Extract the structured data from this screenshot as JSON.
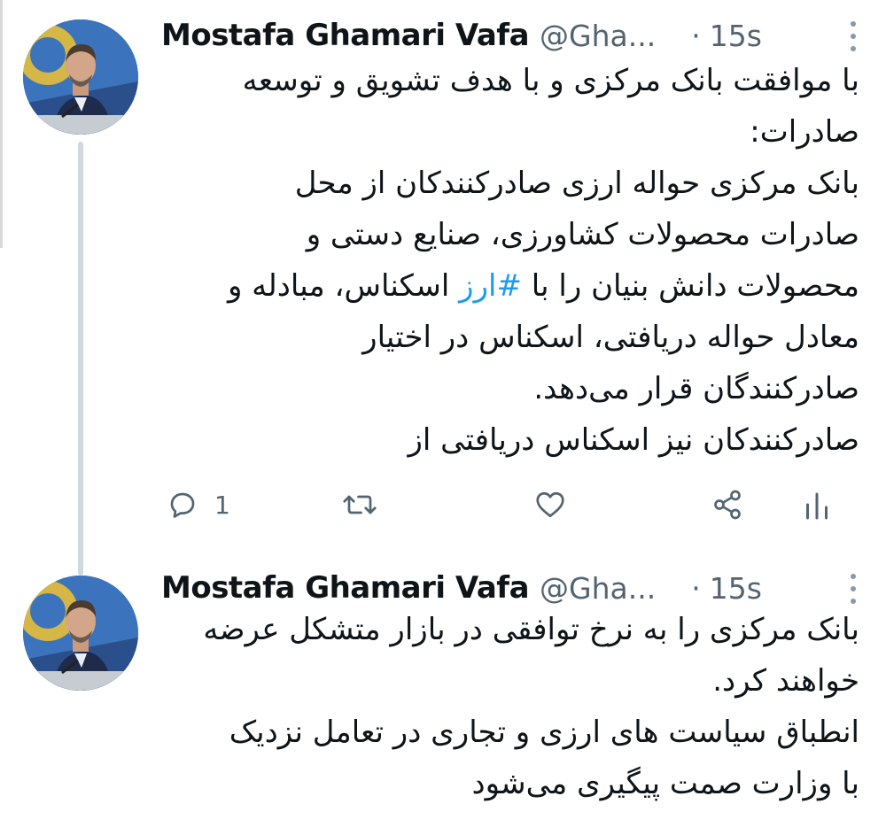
{
  "tweets": [
    {
      "author_name": "Mostafa Ghamari Vafa",
      "handle": "@Gha...",
      "separator": "·",
      "time": "15s",
      "lines": [
        "با موافقت بانک مرکزی و با هدف تشویق و توسعه",
        "صادرات:",
        "بانک مرکزی حواله ارزی صادرکنندکان از محل",
        "صادرات محصولات کشاورزی، صنایع دستی و",
        {
          "before": "محصولات دانش بنیان را با ",
          "hashtag": "#ارز",
          "after": " اسکناس، مبادله و"
        },
        "معادل حواله دریافتی، اسکناس در اختیار",
        "صادرکنندگان قرار می‌دهد.",
        "صادرکنندکان نیز اسکناس دریافتی از"
      ],
      "actions": {
        "reply_icon": "reply-icon",
        "reply_count": "1",
        "retweet_icon": "retweet-icon",
        "like_icon": "heart-icon",
        "share_icon": "share-icon",
        "views_icon": "analytics-icon"
      }
    },
    {
      "author_name": "Mostafa Ghamari Vafa",
      "handle": "@Gha...",
      "separator": "·",
      "time": "15s",
      "lines": [
        "بانک مرکزی را به نرخ توافقی در بازار متشکل عرضه",
        "خواهند کرد.",
        "انطباق سیاست های ارزی و تجاری در تعامل نزدیک",
        "با وزارت صمت پیگیری می‌شود"
      ]
    }
  ],
  "colors": {
    "text": "#0f1419",
    "secondary": "#536471",
    "hashtag": "#1d9bf0",
    "thread_line": "#cfd9de"
  }
}
